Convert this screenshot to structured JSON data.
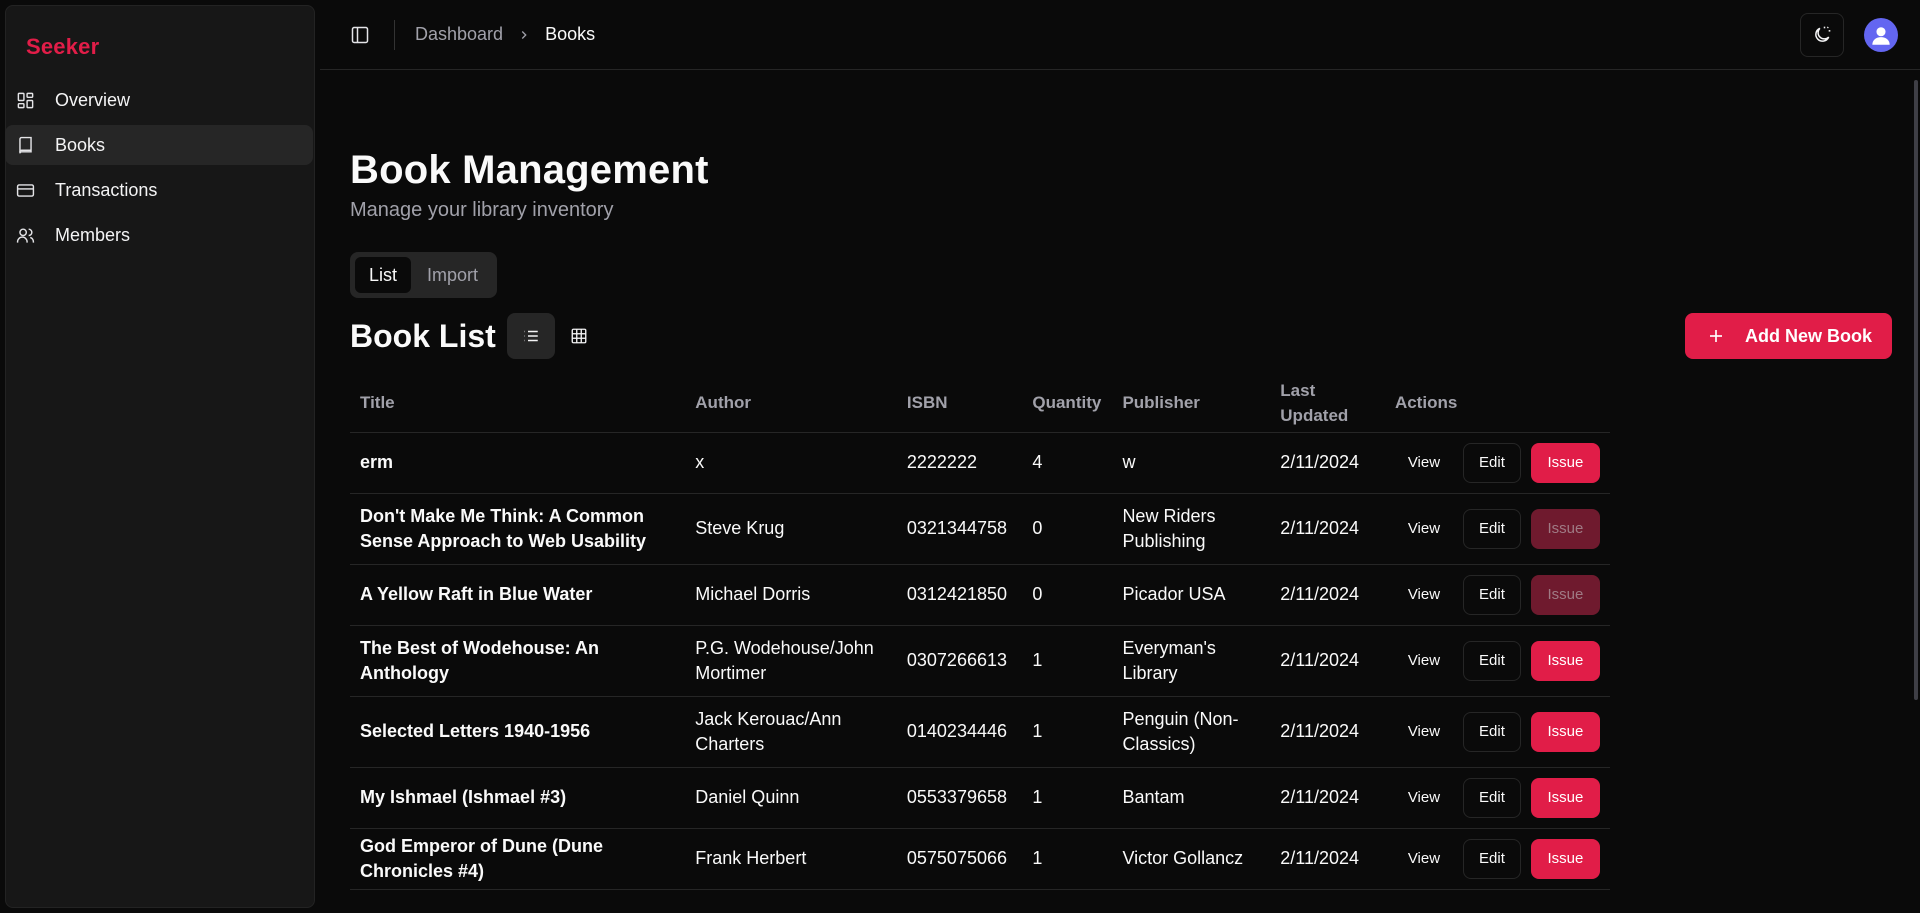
{
  "app": {
    "brand": "Seeker"
  },
  "sidebar": {
    "items": [
      {
        "label": "Overview",
        "icon": "grid-icon",
        "active": false
      },
      {
        "label": "Books",
        "icon": "book-icon",
        "active": true
      },
      {
        "label": "Transactions",
        "icon": "card-icon",
        "active": false
      },
      {
        "label": "Members",
        "icon": "users-icon",
        "active": false
      }
    ]
  },
  "topbar": {
    "breadcrumb": {
      "parent": "Dashboard",
      "current": "Books"
    }
  },
  "page": {
    "title": "Book Management",
    "subtitle": "Manage your library inventory"
  },
  "tabs": [
    {
      "label": "List",
      "active": true
    },
    {
      "label": "Import",
      "active": false
    }
  ],
  "list": {
    "title": "Book List",
    "add_label": "Add New Book"
  },
  "table": {
    "headers": [
      "Title",
      "Author",
      "ISBN",
      "Quantity",
      "Publisher",
      "Last Updated",
      "Actions"
    ],
    "action_labels": {
      "view": "View",
      "edit": "Edit",
      "issue": "Issue"
    },
    "rows": [
      {
        "title": "erm",
        "author": "x",
        "isbn": "2222222",
        "quantity": "4",
        "publisher": "w",
        "updated": "2/11/2024",
        "issue_enabled": true
      },
      {
        "title": "Don't Make Me Think: A Common Sense Approach to Web Usability",
        "author": "Steve Krug",
        "isbn": "0321344758",
        "quantity": "0",
        "publisher": "New Riders Publishing",
        "updated": "2/11/2024",
        "issue_enabled": false
      },
      {
        "title": "A Yellow Raft in Blue Water",
        "author": "Michael Dorris",
        "isbn": "0312421850",
        "quantity": "0",
        "publisher": "Picador USA",
        "updated": "2/11/2024",
        "issue_enabled": false
      },
      {
        "title": "The Best of Wodehouse: An Anthology",
        "author": "P.G. Wodehouse/John Mortimer",
        "isbn": "0307266613",
        "quantity": "1",
        "publisher": "Everyman's Library",
        "updated": "2/11/2024",
        "issue_enabled": true
      },
      {
        "title": "Selected Letters 1940-1956",
        "author": "Jack Kerouac/Ann Charters",
        "isbn": "0140234446",
        "quantity": "1",
        "publisher": "Penguin (Non-Classics)",
        "updated": "2/11/2024",
        "issue_enabled": true
      },
      {
        "title": "My Ishmael (Ishmael #3)",
        "author": "Daniel Quinn",
        "isbn": "0553379658",
        "quantity": "1",
        "publisher": "Bantam",
        "updated": "2/11/2024",
        "issue_enabled": true
      },
      {
        "title": "God Emperor of Dune (Dune Chronicles #4)",
        "author": "Frank Herbert",
        "isbn": "0575075066",
        "quantity": "1",
        "publisher": "Victor Gollancz",
        "updated": "2/11/2024",
        "issue_enabled": true
      }
    ]
  },
  "colors": {
    "accent": "#e11d48",
    "accent_disabled": "#6f1a2e",
    "avatar": "#6366f1"
  }
}
